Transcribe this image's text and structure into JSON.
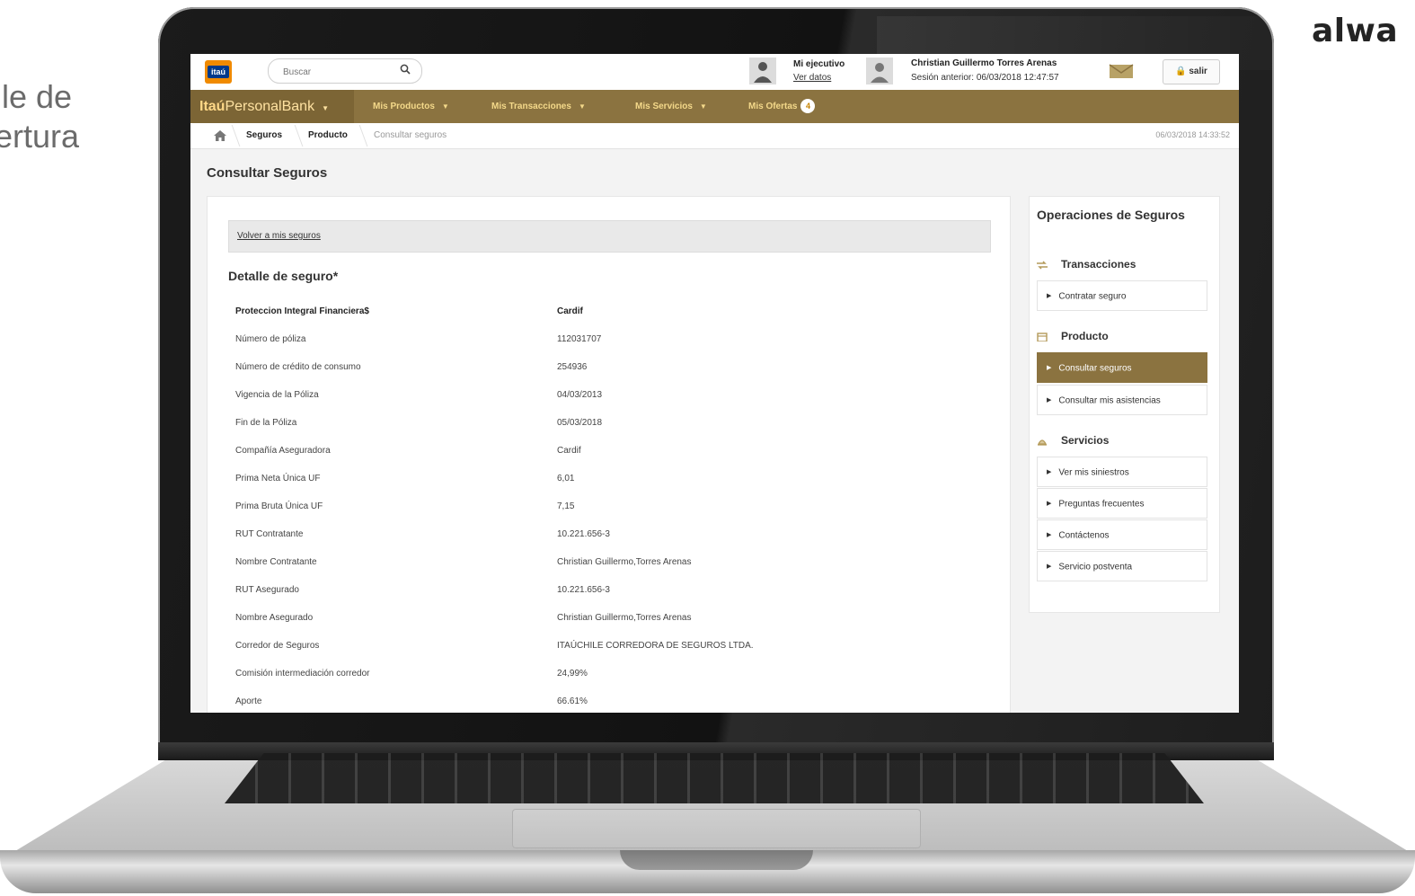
{
  "slide": {
    "title_line1": "lle de",
    "title_line2": "ertura",
    "logo_text": "alwa"
  },
  "topbar": {
    "logo_text": "itaú",
    "search_placeholder": "Buscar",
    "executive_title": "Mi ejecutivo",
    "executive_link": "Ver datos",
    "user_name": "Christian Guillermo Torres Arenas",
    "last_session": "Sesión anterior: 06/03/2018 12:47:57",
    "logout_label": "salir"
  },
  "nav": {
    "brand_bold": "Itaú",
    "brand_rest": "PersonalBank",
    "items": [
      {
        "label": "Mis Productos"
      },
      {
        "label": "Mis Transacciones"
      },
      {
        "label": "Mis Servicios"
      },
      {
        "label": "Mis Ofertas",
        "badge": "4"
      }
    ]
  },
  "breadcrumb": {
    "items": [
      "Seguros",
      "Producto",
      "Consultar seguros"
    ],
    "datetime": "06/03/2018 14:33:52"
  },
  "page": {
    "title": "Consultar Seguros",
    "back_link": "Volver a mis seguros",
    "detail_title": "Detalle de seguro*",
    "header_row": {
      "label": "Proteccion Integral Financiera$",
      "value": "Cardif"
    },
    "rows": [
      {
        "label": "Número de póliza",
        "value": "112031707"
      },
      {
        "label": "Número de crédito de consumo",
        "value": "254936"
      },
      {
        "label": "Vigencia de la Póliza",
        "value": "04/03/2013"
      },
      {
        "label": "Fin de la Póliza",
        "value": "05/03/2018"
      },
      {
        "label": "Compañía Aseguradora",
        "value": "Cardif"
      },
      {
        "label": "Prima Neta Única UF",
        "value": "6,01"
      },
      {
        "label": "Prima Bruta Única UF",
        "value": "7,15"
      },
      {
        "label": "RUT Contratante",
        "value": "10.221.656-3"
      },
      {
        "label": "Nombre Contratante",
        "value": "Christian Guillermo,Torres Arenas"
      },
      {
        "label": "RUT Asegurado",
        "value": "10.221.656-3"
      },
      {
        "label": "Nombre Asegurado",
        "value": "Christian Guillermo,Torres Arenas"
      },
      {
        "label": "Corredor de Seguros",
        "value": "ITAÚCHILE CORREDORA DE SEGUROS LTDA."
      },
      {
        "label": "Comisión intermediación corredor",
        "value": "24,99%"
      },
      {
        "label": "Aporte",
        "value": "66.61%"
      }
    ]
  },
  "sidebar": {
    "title": "Operaciones de Seguros",
    "transacciones": {
      "title": "Transacciones",
      "items": [
        "Contratar seguro"
      ]
    },
    "producto": {
      "title": "Producto",
      "items": [
        "Consultar seguros",
        "Consultar mis asistencias"
      ]
    },
    "servicios": {
      "title": "Servicios",
      "items": [
        "Ver mis siniestros",
        "Preguntas frecuentes",
        "Contáctenos",
        "Servicio postventa"
      ]
    }
  },
  "colors": {
    "nav_bg": "#8b7340",
    "nav_text": "#f4d98a",
    "logo_orange": "#f08a00",
    "logo_blue": "#003a8c"
  }
}
